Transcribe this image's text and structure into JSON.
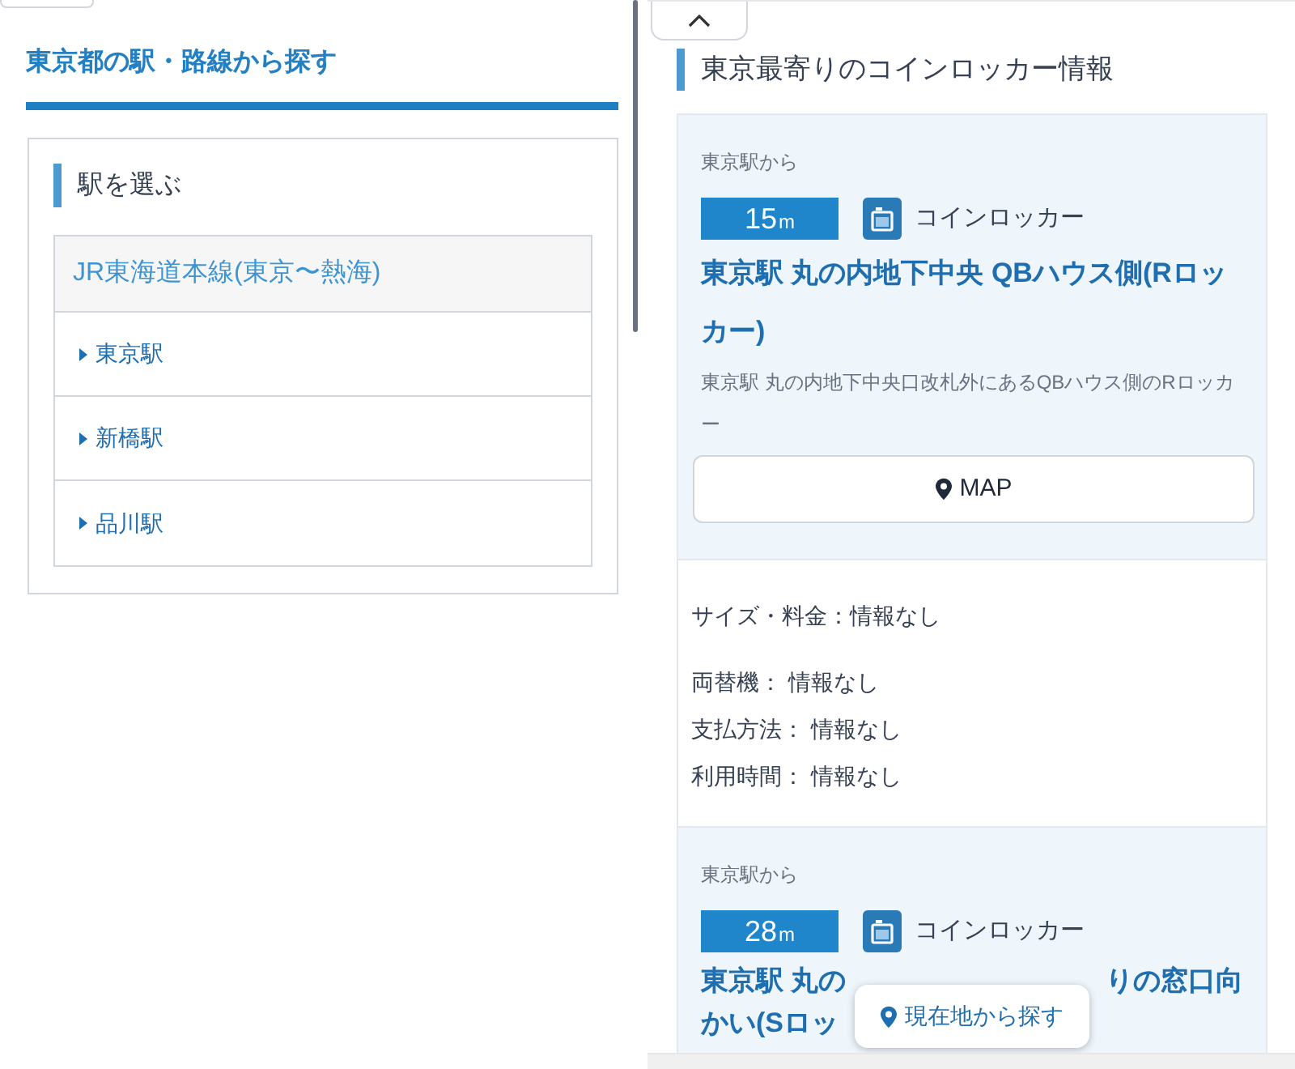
{
  "left": {
    "title": "東京都の駅・路線から探す",
    "section_title": "駅を選ぶ",
    "line_name": "JR東海道本線(東京〜熱海)",
    "stations": [
      {
        "name": "東京駅"
      },
      {
        "name": "新橋駅"
      },
      {
        "name": "品川駅"
      }
    ]
  },
  "right": {
    "heading": "東京最寄りのコインロッカー情報",
    "lockers": [
      {
        "from": "東京駅から",
        "distance": "15",
        "unit": "m",
        "type": "コインロッカー",
        "title_parts": [
          "東京駅 丸の内地下中央 QBハウス側(Rロッカー)"
        ],
        "description": "東京駅 丸の内地下中央口改札外にあるQBハウス側のRロッカー",
        "map_button": "MAP",
        "details": [
          "サイズ・料金：情報なし",
          "両替機： 情報なし",
          "支払方法： 情報なし",
          "利用時間： 情報なし"
        ]
      },
      {
        "from": "東京駅から",
        "distance": "28",
        "unit": "m",
        "type": "コインロッカー",
        "title_parts": [
          "東京駅 丸の",
          "りの窓口向",
          "かい(Sロッ"
        ]
      }
    ]
  },
  "floating_button": {
    "label": "現在地から探す"
  }
}
